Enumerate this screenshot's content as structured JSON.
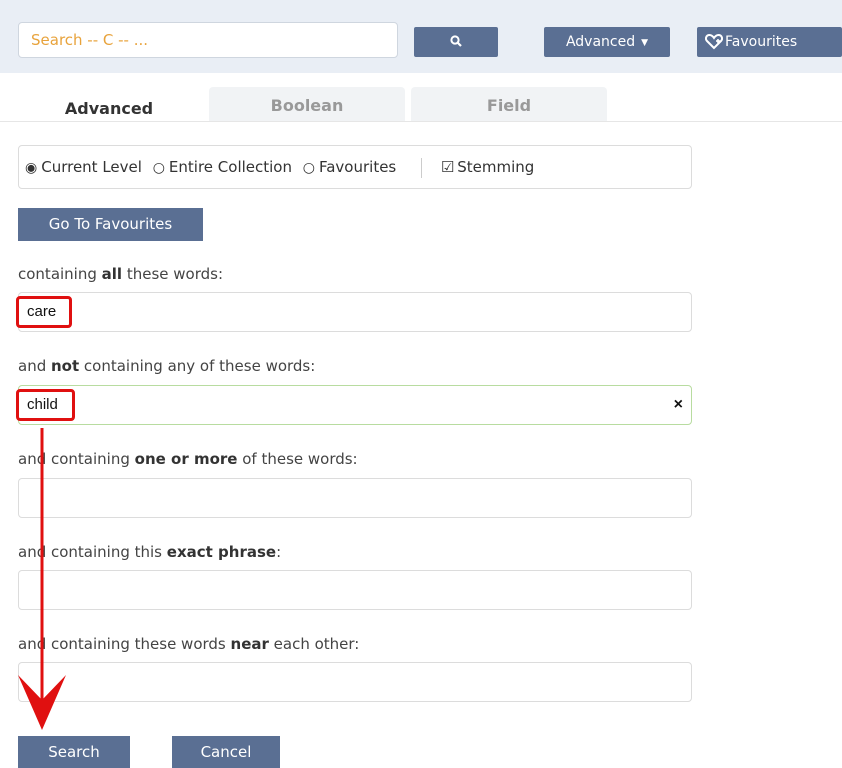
{
  "header": {
    "search_placeholder": "Search -- C -- ...",
    "search_icon": "search-icon",
    "advanced_label": "Advanced",
    "favourites_label": "Favourites"
  },
  "tabs": [
    {
      "label": "Advanced",
      "active": true
    },
    {
      "label": "Boolean",
      "active": false
    },
    {
      "label": "Field",
      "active": false
    }
  ],
  "scope": {
    "options": [
      "Current Level",
      "Entire Collection",
      "Favourites"
    ],
    "selected": "Current Level",
    "stemming_label": "Stemming",
    "stemming_checked": true
  },
  "goto_favourites_label": "Go To Favourites",
  "fields": {
    "all_words": {
      "label_pre": "containing ",
      "label_bold": "all",
      "label_post": " these words:",
      "value": "care"
    },
    "not_words": {
      "label_pre": "and ",
      "label_bold": "not",
      "label_post": " containing any of these words:",
      "value": "child"
    },
    "one_or_more": {
      "label_pre": "and containing ",
      "label_bold": "one or more",
      "label_post": " of these words:",
      "value": ""
    },
    "exact_phrase": {
      "label_pre": "and containing this ",
      "label_bold": "exact phrase",
      "label_post": ":",
      "value": ""
    },
    "near": {
      "label_pre": "and containing these words ",
      "label_bold": "near",
      "label_post": " each other:",
      "value": ""
    }
  },
  "buttons": {
    "search": "Search",
    "cancel": "Cancel"
  },
  "colors": {
    "accent": "#5a6f93",
    "highlight": "#e01010",
    "placeholder": "#e8a33c"
  }
}
